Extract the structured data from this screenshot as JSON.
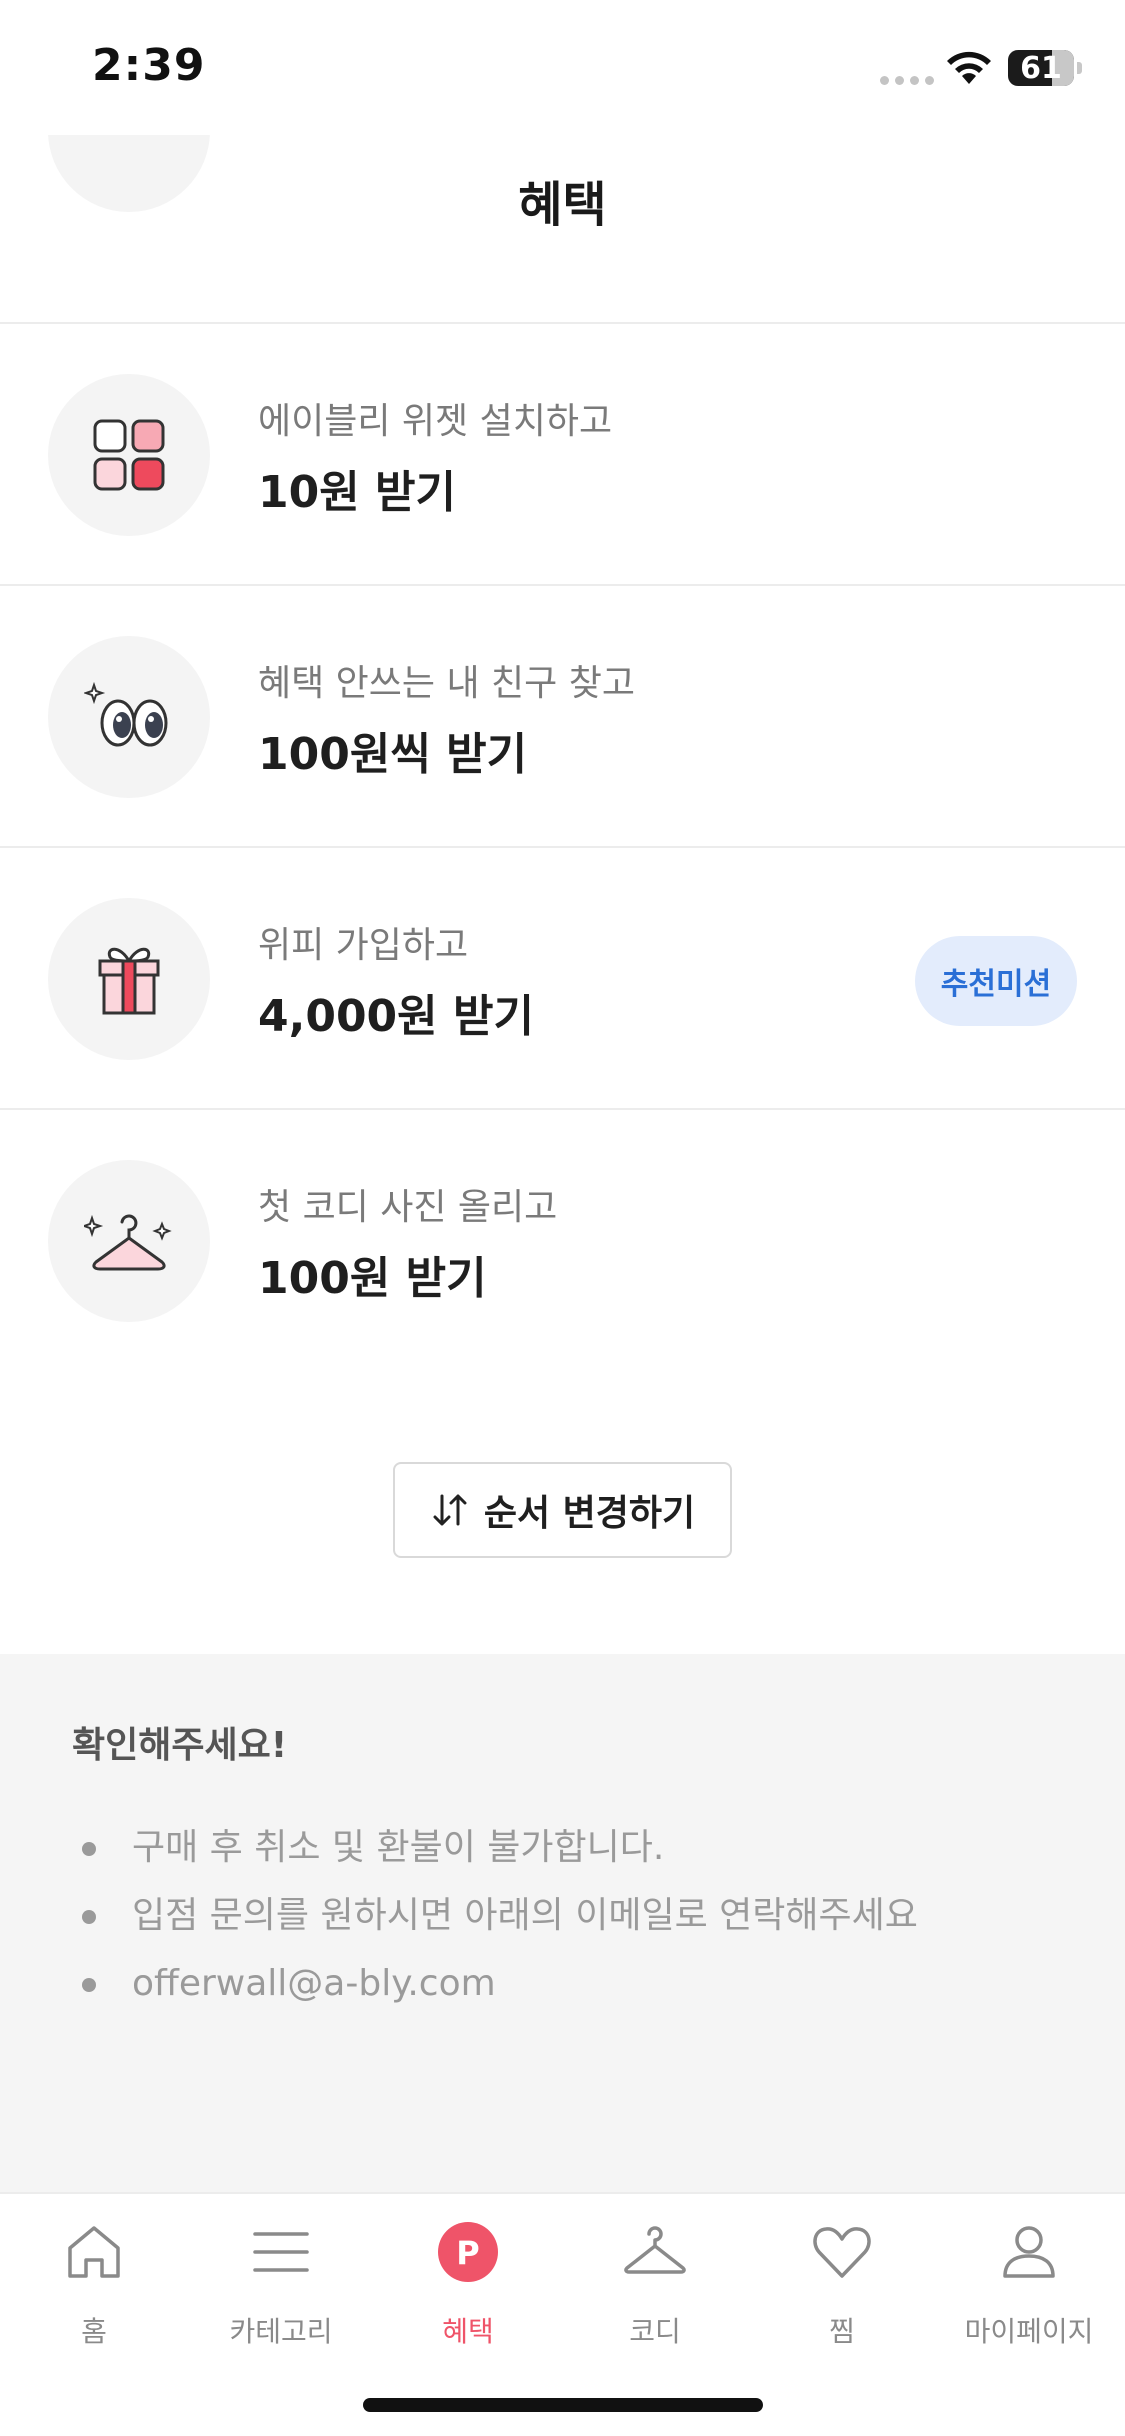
{
  "status_bar": {
    "time": "2:39",
    "battery": "61"
  },
  "header": {
    "title": "혜택"
  },
  "missions": [
    {
      "subtitle": "에이블리 위젯 설치하고",
      "reward": "10원 받기",
      "icon": "widget-icon"
    },
    {
      "subtitle": "혜택 안쓰는 내 친구 찾고",
      "reward": "100원씩 받기",
      "icon": "eyes-icon"
    },
    {
      "subtitle": "위피 가입하고",
      "reward": "4,000원 받기",
      "icon": "gift-icon",
      "badge": "추천미션"
    },
    {
      "subtitle": "첫 코디 사진 올리고",
      "reward": "100원 받기",
      "icon": "hanger-icon"
    }
  ],
  "reorder": {
    "label": "순서 변경하기"
  },
  "notice": {
    "title": "확인해주세요!",
    "items": [
      "구매 후 취소 및 환불이 불가합니다.",
      "입점 문의를 원하시면 아래의 이메일로 연락해주세요",
      "offerwall@a-bly.com"
    ]
  },
  "tabs": [
    {
      "label": "홈",
      "icon": "home-icon"
    },
    {
      "label": "카테고리",
      "icon": "menu-icon"
    },
    {
      "label": "혜택",
      "icon": "points-icon",
      "active": true,
      "icon_letter": "P"
    },
    {
      "label": "코디",
      "icon": "hanger-icon"
    },
    {
      "label": "찜",
      "icon": "heart-icon"
    },
    {
      "label": "마이페이지",
      "icon": "user-icon"
    }
  ],
  "colors": {
    "accent": "#ef5469",
    "badge_bg": "#e3ecfc",
    "badge_text": "#2a6fd6",
    "notice_bg": "#f5f5f5"
  }
}
